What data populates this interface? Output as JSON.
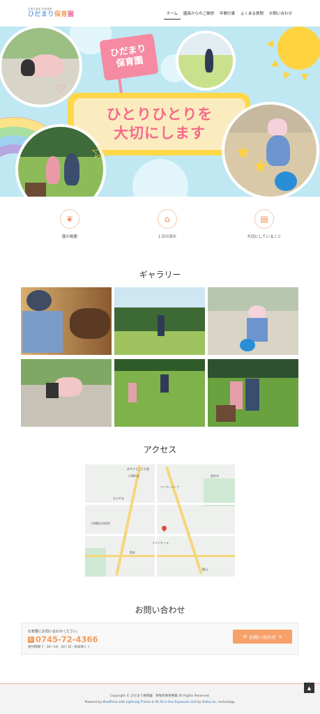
{
  "header": {
    "logo_sub": "企業主導型 保育施設",
    "logo_parts": [
      "ひだまり",
      "保育",
      "園"
    ],
    "nav": [
      "ホーム",
      "園長からのご挨拶",
      "年間行事",
      "よくある質問",
      "お問い合わせ"
    ]
  },
  "hero": {
    "flag_line1": "ひだまり",
    "flag_line2": "保育園",
    "title_line1": "ひとりひとりを",
    "title_line2": "大切にします"
  },
  "features": [
    {
      "label": "園の概要",
      "icon": "bird-icon"
    },
    {
      "label": "１日の流れ",
      "icon": "house-icon"
    },
    {
      "label": "大切にしていること",
      "icon": "document-icon"
    }
  ],
  "gallery": {
    "title": "ギャラリー"
  },
  "access": {
    "title": "アクセス",
    "map_labels": [
      "あやさとこども園",
      "小泉町北",
      "桜井市",
      "アーアーコープ",
      "ならやま",
      "大和郡山市役所",
      "イオンモール",
      "筒井",
      "郡山"
    ]
  },
  "contact": {
    "title": "お問い合わせ",
    "note": "お気軽にお問い合わせください。",
    "phone": "0745-72-4366",
    "hours": "受付時間 7：30～19：30 [ 日・祝日除く ]",
    "button": "お問い合わせ"
  },
  "footer": {
    "copyright": "Copyright © ひだまり保育園　男性的保育事業 All Rights Reserved.",
    "powered_prefix": "Powered by ",
    "powered_wp": "WordPress",
    "powered_mid1": " with ",
    "powered_theme": "Lightning Theme",
    "powered_mid2": " & ",
    "powered_plugin": "VK All in One Expansion Unit",
    "powered_mid3": " by ",
    "powered_vektor": "Vektor,Inc.",
    "powered_suffix": " technology."
  },
  "colors": {
    "accent": "#f39c5a",
    "pink": "#f58aa2",
    "sky": "#bfe8f3",
    "yellow": "#ffd84a"
  }
}
